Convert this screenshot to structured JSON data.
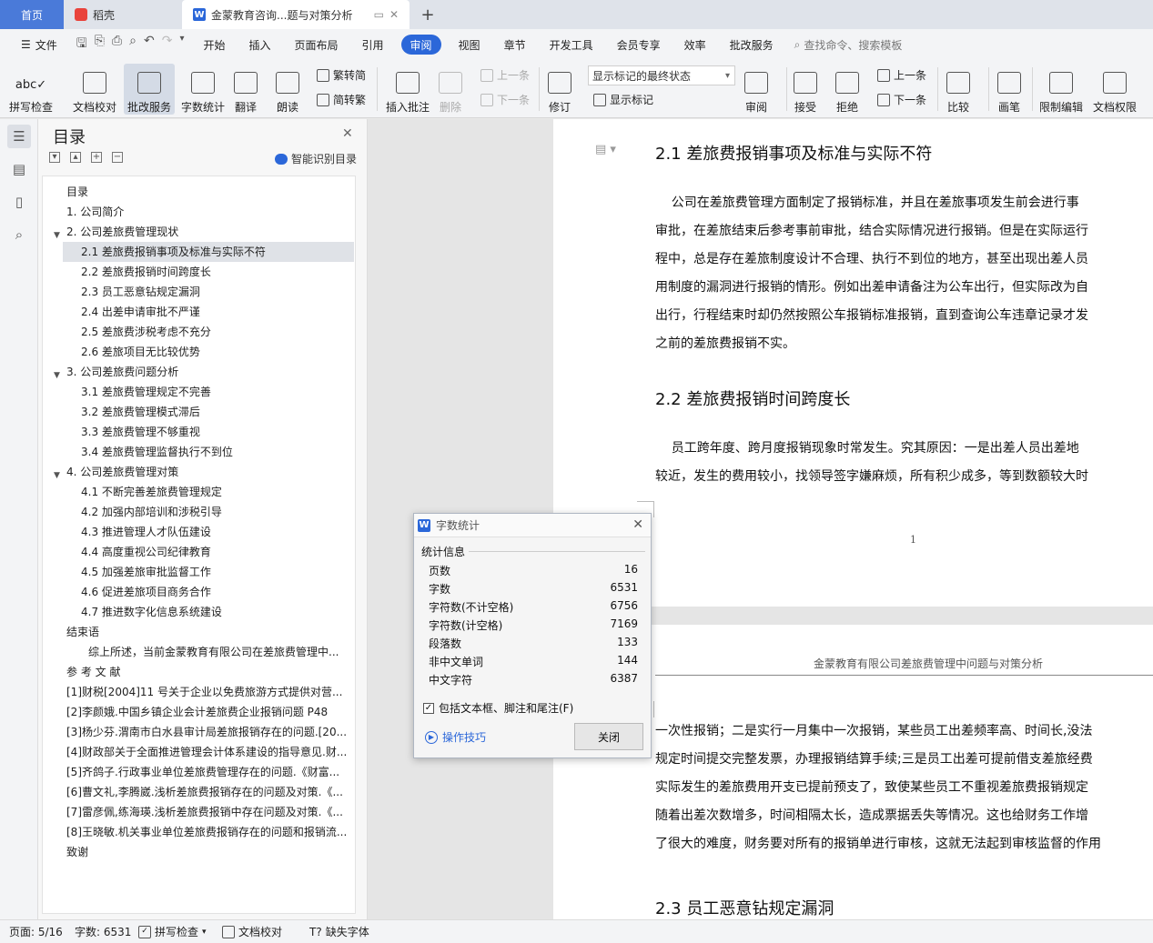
{
  "tabs": {
    "home": "首页",
    "docer": "稻壳",
    "doc_title": "金蒙教育咨询...题与对策分析",
    "add": "+"
  },
  "menu": {
    "file": "文件",
    "items": [
      "开始",
      "插入",
      "页面布局",
      "引用",
      "审阅",
      "视图",
      "章节",
      "开发工具",
      "会员专享",
      "效率",
      "批改服务"
    ],
    "active": "审阅",
    "search_placeholder": "查找命令、搜索模板"
  },
  "ribbon": {
    "spell_check": "拼写检查",
    "doc_proof": "文档校对",
    "review_service": "批改服务",
    "word_count": "字数统计",
    "translate": "翻译",
    "read_aloud": "朗读",
    "trad_simp": "繁转简",
    "simp_trad": "简转繁",
    "insert_comment": "插入批注",
    "delete": "删除",
    "prev_comment": "上一条",
    "next_comment": "下一条",
    "track_changes": "修订",
    "markup_mode": "显示标记的最终状态",
    "show_markup": "显示标记",
    "review": "审阅",
    "accept": "接受",
    "reject": "拒绝",
    "prev_change": "上一条",
    "next_change": "下一条",
    "compare": "比较",
    "pen": "画笔",
    "restrict_edit": "限制编辑",
    "doc_permission": "文档权限"
  },
  "toc": {
    "title": "目录",
    "smart": "智能识别目录",
    "items": [
      "目录",
      "1. 公司简介",
      "2. 公司差旅费管理现状",
      "2.1 差旅费报销事项及标准与实际不符",
      "2.2 差旅费报销时间跨度长",
      "2.3 员工恶意钻规定漏洞",
      "2.4 出差申请审批不严谨",
      "2.5 差旅费涉税考虑不充分",
      "2.6 差旅项目无比较优势",
      "3. 公司差旅费问题分析",
      "3.1 差旅费管理规定不完善",
      "3.2 差旅费管理模式滞后",
      "3.3 差旅费管理不够重视",
      "3.4 差旅费管理监督执行不到位",
      "4. 公司差旅费管理对策",
      "4.1 不断完善差旅费管理规定",
      "4.2 加强内部培训和涉税引导",
      "4.3 推进管理人才队伍建设",
      "4.4 高度重视公司纪律教育",
      "4.5 加强差旅审批监督工作",
      "4.6 促进差旅项目商务合作",
      "4.7 推进数字化信息系统建设",
      "结束语",
      "综上所述，当前金蒙教育有限公司在差旅费管理中...",
      "参 考 文 献",
      "[1]财税[2004]11 号关于企业以免费旅游方式提供对营...",
      "[2]李颜娥.中国乡镇企业会计差旅费企业报销问题 P48",
      "[3]杨少芬.渭南市白水县审计局差旅报销存在的问题.[20...",
      "[4]财政部关于全面推进管理会计体系建设的指导意见.财...",
      "[5]齐鸽子.行政事业单位差旅费管理存在的问题.《财富...",
      "[6]曹文礼,李腾崴.浅析差旅费报销存在的问题及对策.《...",
      "[7]雷彦佩,练海瑛.浅析差旅费报销中存在问题及对策.《...",
      "[8]王晓敏.机关事业单位差旅费报销存在的问题和报销流...",
      "致谢"
    ]
  },
  "document": {
    "h21": "2.1  差旅费报销事项及标准与实际不符",
    "p21": [
      "    公司在差旅费管理方面制定了报销标准，并且在差旅事项发生前会进行事",
      "审批，在差旅结束后参考事前审批，结合实际情况进行报销。但是在实际运行",
      "程中，总是存在差旅制度设计不合理、执行不到位的地方，甚至出现出差人员",
      "用制度的漏洞进行报销的情形。例如出差申请备注为公车出行，但实际改为自",
      "出行，行程结束时却仍然按照公车报销标准报销，直到查询公车违章记录才发",
      "之前的差旅费报销不实。"
    ],
    "h22": "2.2  差旅费报销时间跨度长",
    "p22": [
      "    员工跨年度、跨月度报销现象时常发生。究其原因：一是出差人员出差地",
      "较近，发生的费用较小，找领导签字嫌麻烦，所有积少成多，等到数额较大时"
    ],
    "page_num": "1",
    "running_header": "金蒙教育有限公司差旅费管理中问题与对策分析",
    "p_cont": [
      "一次性报销；二是实行一月集中一次报销，某些员工出差频率高、时间长,没法",
      "规定时间提交完整发票，办理报销结算手续;三是员工出差可提前借支差旅经费",
      "实际发生的差旅费用开支已提前预支了，致使某些员工不重视差旅费报销规定",
      "随着出差次数增多，时间相隔太长，造成票据丢失等情况。这也给财务工作增",
      "了很大的难度，财务要对所有的报销单进行审核，这就无法起到审核监督的作用"
    ],
    "h23": "2.3  员工恶意钻规定漏洞"
  },
  "dialog": {
    "title": "字数统计",
    "group": "统计信息",
    "stats": [
      {
        "label": "页数",
        "value": "16"
      },
      {
        "label": "字数",
        "value": "6531"
      },
      {
        "label": "字符数(不计空格)",
        "value": "6756"
      },
      {
        "label": "字符数(计空格)",
        "value": "7169"
      },
      {
        "label": "段落数",
        "value": "133"
      },
      {
        "label": "非中文单词",
        "value": "144"
      },
      {
        "label": "中文字符",
        "value": "6387"
      }
    ],
    "include_label": "包括文本框、脚注和尾注(F)",
    "include_checked": true,
    "tips": "操作技巧",
    "close": "关闭"
  },
  "status": {
    "page": "页面: 5/16",
    "words": "字数: 6531",
    "spell": "拼写检查",
    "proof": "文档校对",
    "missing_font": "缺失字体"
  }
}
